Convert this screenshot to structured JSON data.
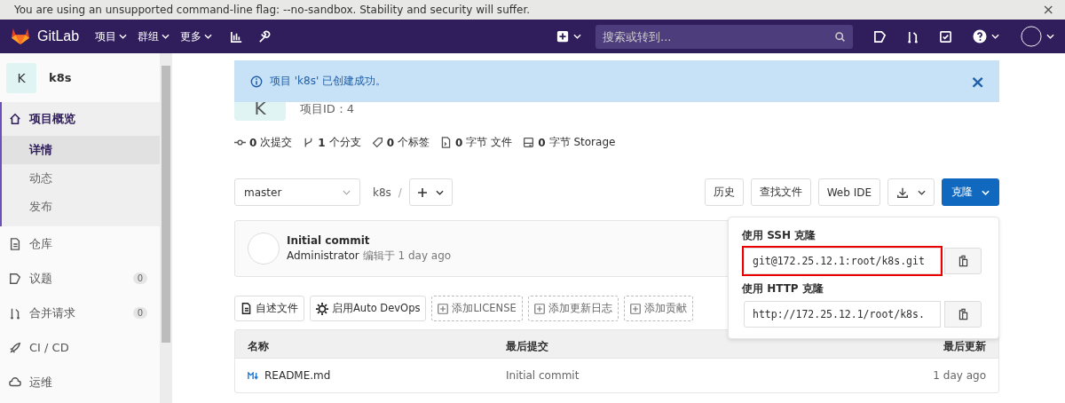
{
  "infobar": {
    "message": "You are using an unsupported command-line flag: --no-sandbox. Stability and security will suffer.",
    "close": "×"
  },
  "navbar": {
    "brand": "GitLab",
    "menus": [
      "项目",
      "群组",
      "更多"
    ],
    "search": {
      "placeholder": "搜索或转到..."
    }
  },
  "sidebar": {
    "project": {
      "avatar": "K",
      "name": "k8s"
    },
    "items": [
      {
        "label": "项目概览",
        "selected": true,
        "children": [
          {
            "label": "详情",
            "selected": true
          },
          {
            "label": "动态",
            "selected": false
          },
          {
            "label": "发布",
            "selected": false
          }
        ]
      },
      {
        "label": "仓库",
        "selected": false
      },
      {
        "label": "议题",
        "selected": false,
        "count": "0"
      },
      {
        "label": "合并请求",
        "selected": false,
        "count": "0"
      },
      {
        "label": "CI / CD",
        "selected": false
      },
      {
        "label": "运维",
        "selected": false
      }
    ]
  },
  "flash": {
    "message": "项目 'k8s' 已创建成功。",
    "close": "×"
  },
  "project": {
    "avatar": "K",
    "id_label": "项目ID：4"
  },
  "stats": [
    {
      "value": "0",
      "label": "次提交"
    },
    {
      "value": "1",
      "label": "个分支"
    },
    {
      "value": "0",
      "label": "个标签"
    },
    {
      "value": "0",
      "label": "字节 文件"
    },
    {
      "value": "0",
      "label": "字节 Storage"
    }
  ],
  "toolbar": {
    "branch": "master",
    "path": "k8s",
    "separator": "/",
    "buttons": [
      "历史",
      "查找文件",
      "Web IDE"
    ],
    "clone": "克隆"
  },
  "commit": {
    "title": "Initial commit",
    "author": "Administrator",
    "meta": "编辑于 1 day ago"
  },
  "actions": [
    {
      "label": "自述文件",
      "kind": "file"
    },
    {
      "label": "启用Auto DevOps",
      "kind": "gear"
    },
    {
      "label": "添加LICENSE",
      "kind": "add"
    },
    {
      "label": "添加更新日志",
      "kind": "add"
    },
    {
      "label": "添加贡献",
      "kind": "add"
    }
  ],
  "table": {
    "columns": [
      "名称",
      "最后提交",
      "最后更新"
    ],
    "rows": [
      {
        "name": "README.md",
        "commit": "Initial commit",
        "updated": "1 day ago"
      }
    ]
  },
  "clone_menu": {
    "options": [
      {
        "label": "使用 SSH 克隆",
        "url": "git@172.25.12.1:root/k8s.git",
        "highlighted": true
      },
      {
        "label": "使用 HTTP 克隆",
        "url": "http://172.25.12.1/root/k8s.",
        "highlighted": false
      }
    ]
  }
}
